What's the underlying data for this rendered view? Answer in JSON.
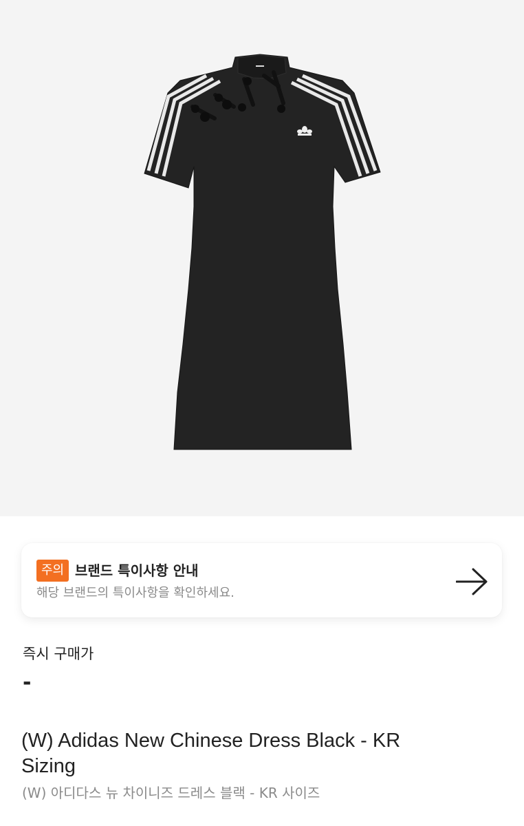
{
  "product": {
    "image_alt": "black short-sleeve dress with white three stripes and knot buttons",
    "title_en": "(W) Adidas New Chinese Dress Black - KR Sizing",
    "title_kr": "(W) 아디다스 뉴 차이니즈 드레스 블랙 - KR 사이즈"
  },
  "notice": {
    "badge": "주의",
    "title": "브랜드 특이사항 안내",
    "subtitle": "해당 브랜드의 특이사항을 확인하세요.",
    "arrow_icon": "arrow-right-icon"
  },
  "price": {
    "label": "즉시 구매가",
    "value": "-"
  },
  "colors": {
    "accent": "#f36f21",
    "hero_bg": "#f4f4f4",
    "dress": "#232323",
    "text_primary": "#222222",
    "text_secondary": "#8a8a8a"
  }
}
